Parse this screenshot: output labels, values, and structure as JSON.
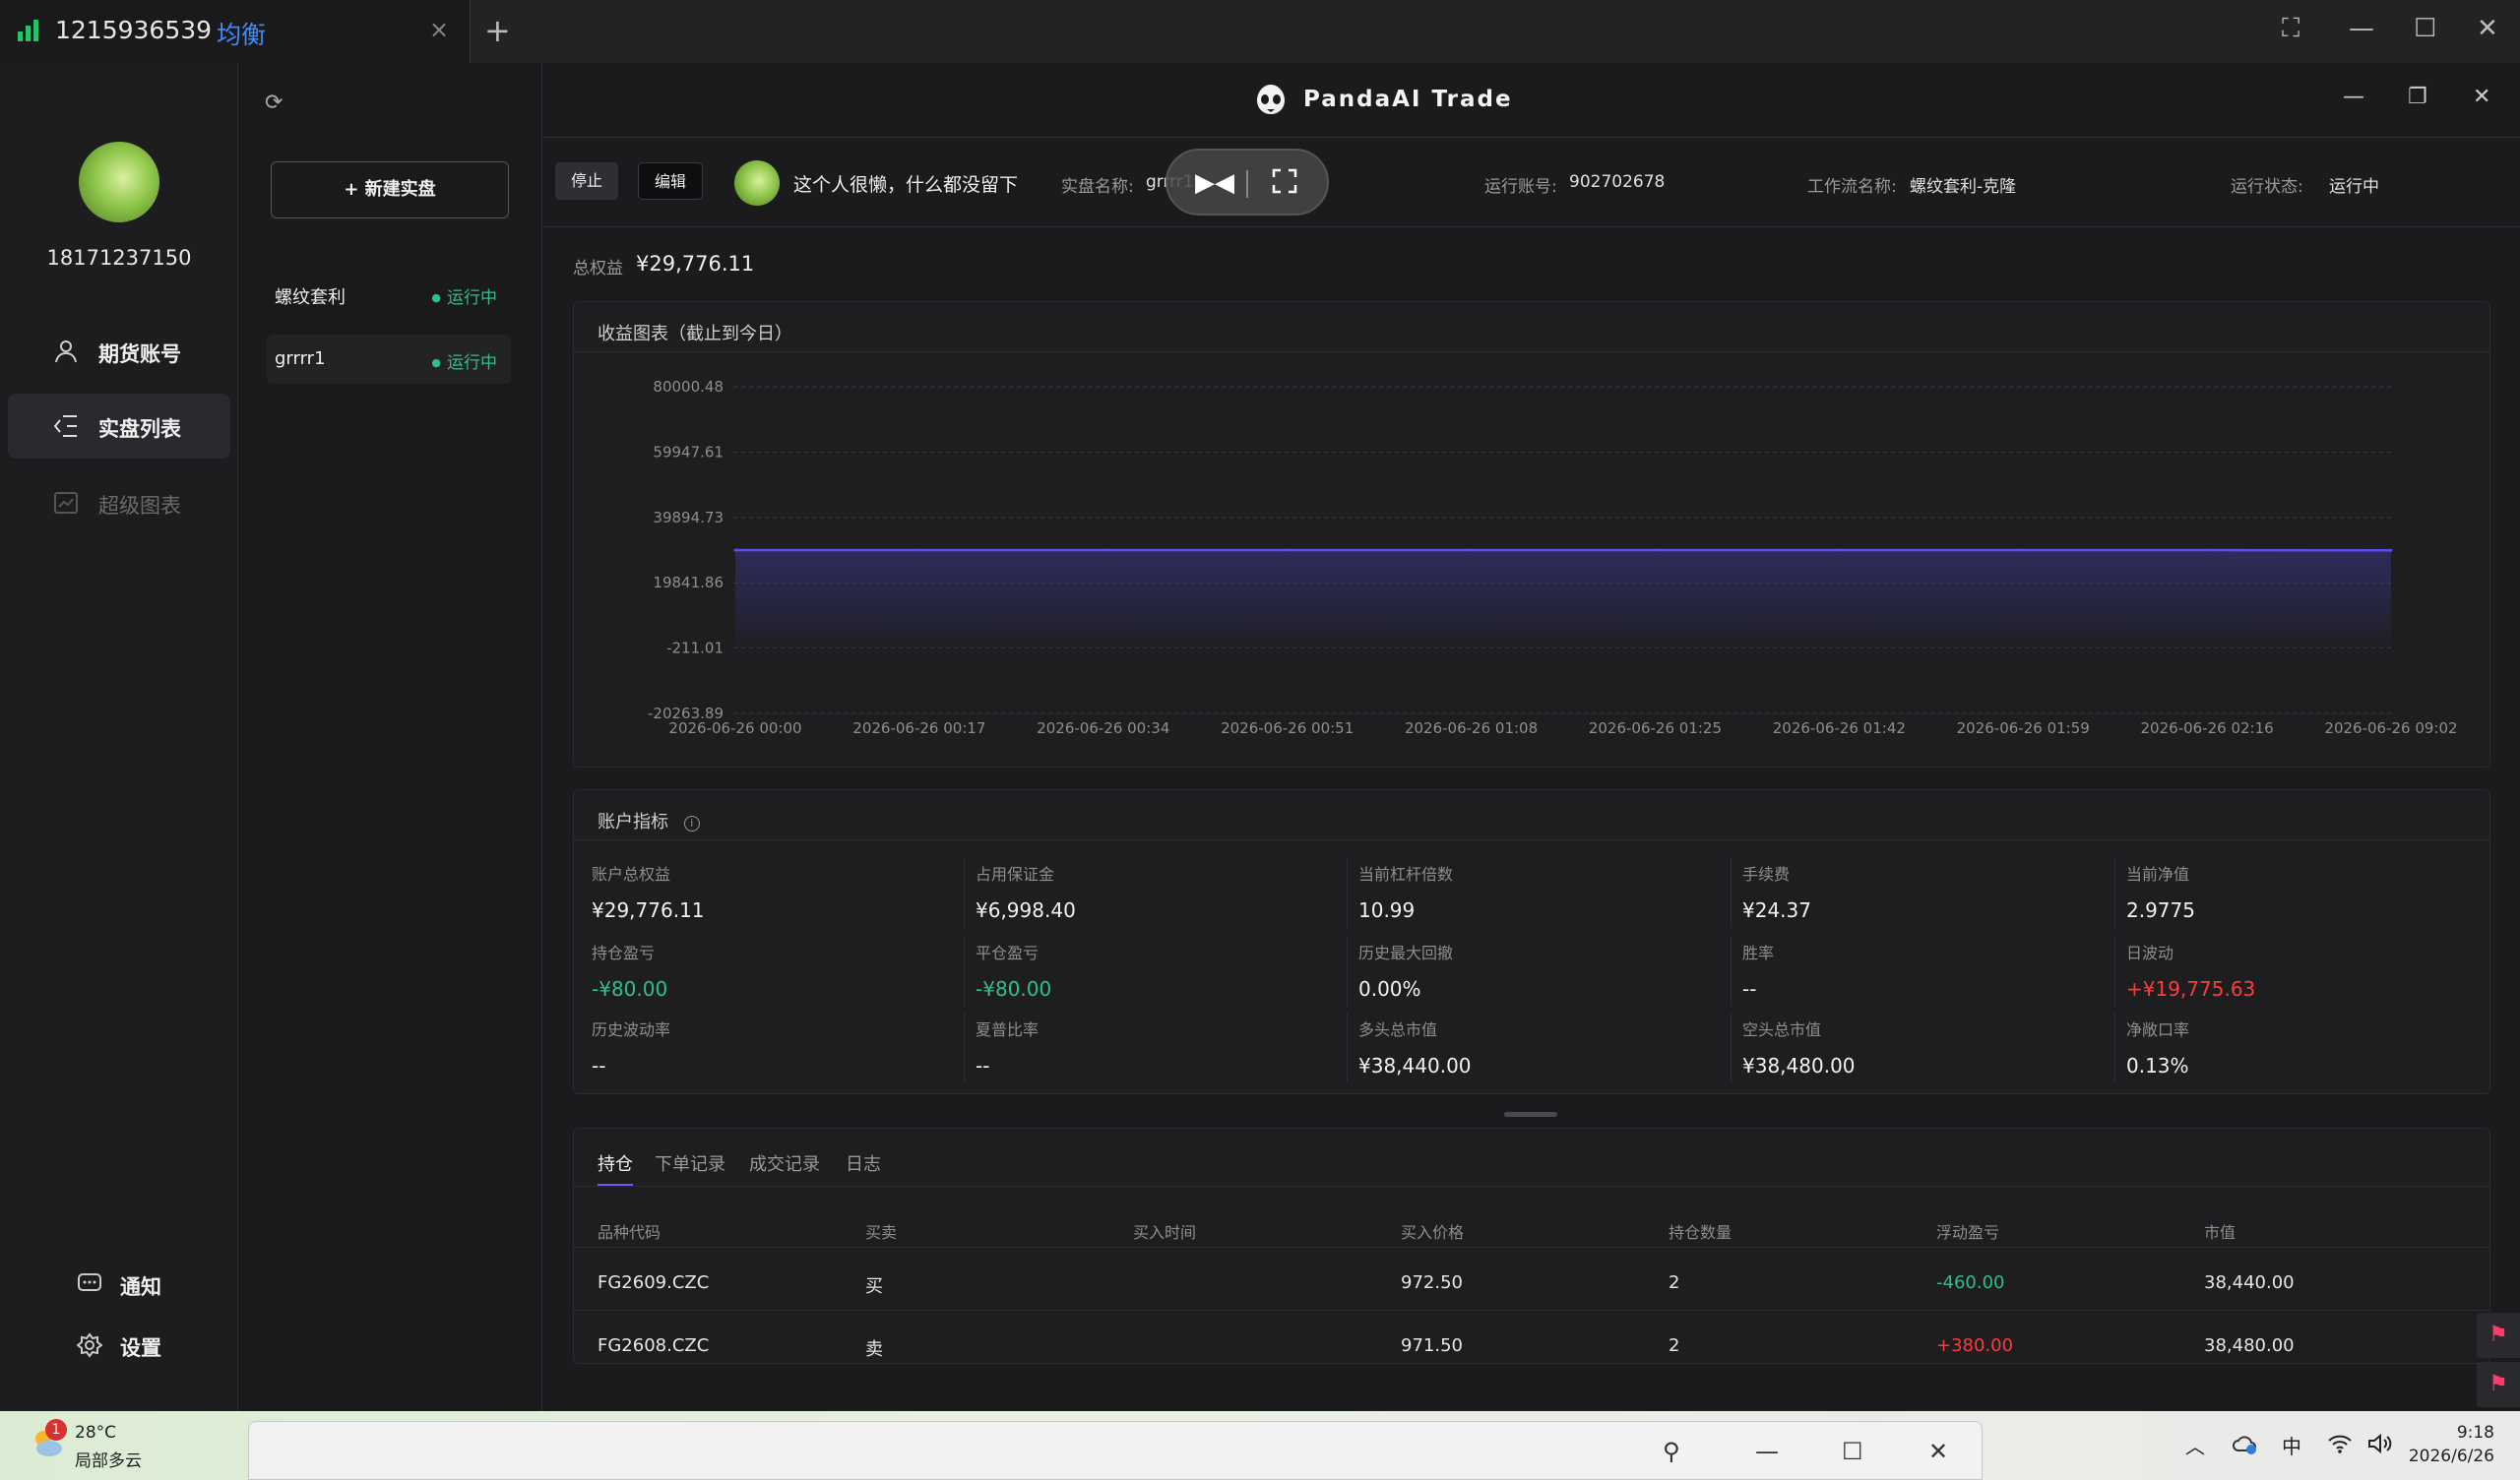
{
  "tab": {
    "account": "1215936539",
    "mode": "均衡",
    "close": "×",
    "new": "+"
  },
  "window": {
    "fullscreen": "⛶",
    "minimize": "—",
    "maximize": "☐",
    "close": "✕"
  },
  "user": {
    "phone": "18171237150"
  },
  "nav": {
    "items": [
      {
        "label": "期货账号",
        "icon": "user-icon"
      },
      {
        "label": "实盘列表",
        "icon": "list-icon"
      },
      {
        "label": "超级图表",
        "icon": "chart-icon"
      }
    ],
    "notify": "通知",
    "settings": "设置"
  },
  "trades": {
    "new_button": "+ 新建实盘",
    "list": [
      {
        "name": "螺纹套利",
        "status": "运行中"
      },
      {
        "name": "grrrr1",
        "status": "运行中"
      }
    ]
  },
  "app": {
    "title": "PandaAI Trade"
  },
  "info": {
    "stop": "停止",
    "edit": "编辑",
    "motto": "这个人很懒，什么都没留下",
    "name_label": "实盘名称:",
    "name_value": "grrrr1",
    "account_label": "运行账号:",
    "account_value": "902702678",
    "workflow_label": "工作流名称:",
    "workflow_value": "螺纹套利-克隆",
    "status_label": "运行状态:",
    "status_value": "运行中"
  },
  "equity": {
    "label": "总权益",
    "value": "¥29,776.11"
  },
  "chart_panel_title": "收益图表（截止到今日）",
  "chart_data": {
    "type": "area",
    "title": "收益图表（截止到今日）",
    "x": [
      "2026-06-26 00:00",
      "2026-06-26 00:17",
      "2026-06-26 00:34",
      "2026-06-26 00:51",
      "2026-06-26 01:08",
      "2026-06-26 01:25",
      "2026-06-26 01:42",
      "2026-06-26 01:59",
      "2026-06-26 02:16",
      "2026-06-26 09:02"
    ],
    "y_ticks": [
      "80000.48",
      "59947.61",
      "39894.73",
      "19841.86",
      "-211.01",
      "-20263.89"
    ],
    "ylim": [
      -20263.89,
      80000.48
    ],
    "series": [
      {
        "values": [
          29856.11,
          29856.11,
          29856.11,
          29856.11,
          29856.11,
          29856.11,
          29856.11,
          29856.11,
          29856.11,
          29776.11
        ]
      }
    ],
    "color": "#5a4ff0",
    "grid": true
  },
  "metrics": {
    "title": "账户指标",
    "rows": [
      [
        {
          "k": "账户总权益",
          "v": "¥29,776.11",
          "c": ""
        },
        {
          "k": "占用保证金",
          "v": "¥6,998.40",
          "c": ""
        },
        {
          "k": "当前杠杆倍数",
          "v": "10.99",
          "c": ""
        },
        {
          "k": "手续费",
          "v": "¥24.37",
          "c": ""
        },
        {
          "k": "当前净值",
          "v": "2.9775",
          "c": ""
        }
      ],
      [
        {
          "k": "持仓盈亏",
          "v": "-¥80.00",
          "c": "green"
        },
        {
          "k": "平仓盈亏",
          "v": "-¥80.00",
          "c": "green"
        },
        {
          "k": "历史最大回撤",
          "v": "0.00%",
          "c": ""
        },
        {
          "k": "胜率",
          "v": "--",
          "c": ""
        },
        {
          "k": "日波动",
          "v": "+¥19,775.63",
          "c": "red"
        }
      ],
      [
        {
          "k": "历史波动率",
          "v": "--",
          "c": ""
        },
        {
          "k": "夏普比率",
          "v": "--",
          "c": ""
        },
        {
          "k": "多头总市值",
          "v": "¥38,440.00",
          "c": ""
        },
        {
          "k": "空头总市值",
          "v": "¥38,480.00",
          "c": ""
        },
        {
          "k": "净敞口率",
          "v": "0.13%",
          "c": ""
        }
      ]
    ]
  },
  "positions": {
    "tabs": [
      "持仓",
      "下单记录",
      "成交记录",
      "日志"
    ],
    "headers": [
      "品种代码",
      "买卖",
      "买入时间",
      "买入价格",
      "持仓数量",
      "浮动盈亏",
      "市值"
    ],
    "rows": [
      [
        "FG2609.CZC",
        "买",
        "",
        "972.50",
        "2",
        "-460.00",
        "38,440.00"
      ],
      [
        "FG2608.CZC",
        "卖",
        "",
        "971.50",
        "2",
        "+380.00",
        "38,480.00"
      ]
    ]
  },
  "taskbar": {
    "temp": "28°C",
    "weather": "局部多云",
    "badge": "1",
    "ime": "中",
    "time": "9:18",
    "date": "2026/6/26"
  }
}
